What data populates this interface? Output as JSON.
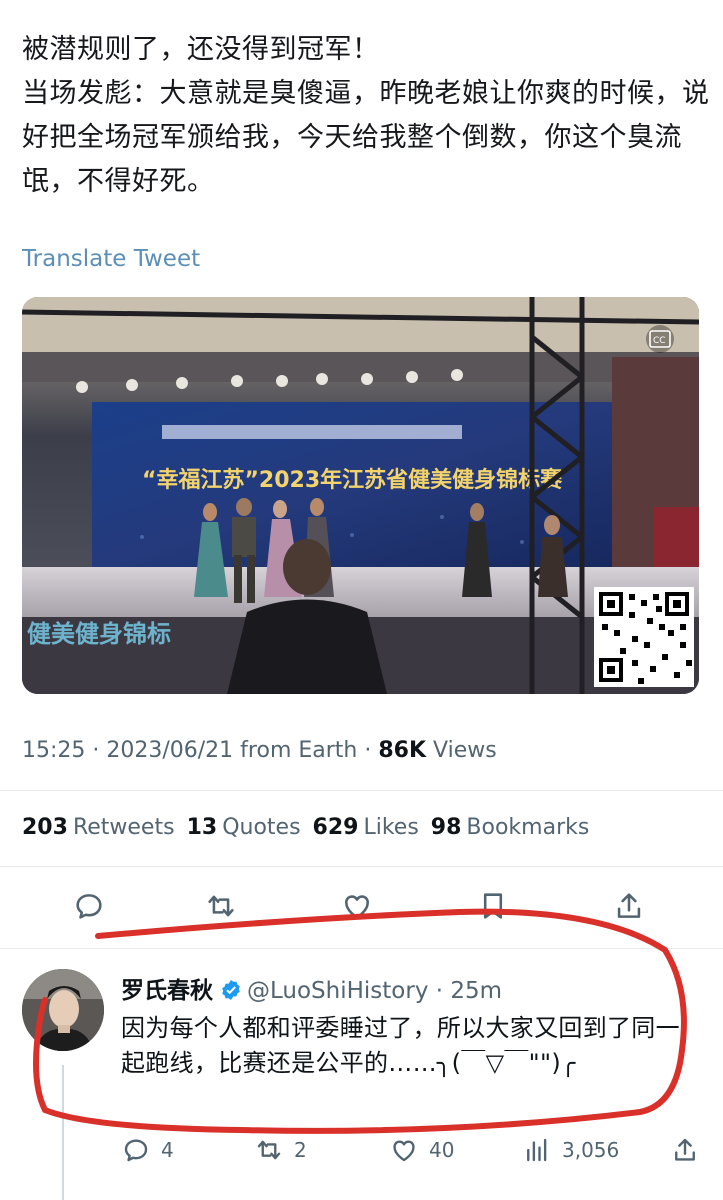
{
  "tweet": {
    "text": "被潜规则了，还没得到冠军！\n当场发彪：大意就是臭傻逼，昨晚老娘让你爽的时候，说好把全场冠军颁给我，今天给我整个倒数，你这个臭流氓，不得好死。",
    "translate_label": "Translate Tweet",
    "media": {
      "banner_text": "“幸福江苏”2023年江苏省健美健身锦标赛",
      "stage_text": "健美健身锦标",
      "cc_badge": "CC"
    },
    "time": "15:25 · 2023/06/21 from Earth · ",
    "views_count": "86K",
    "views_label": " Views",
    "stats": [
      {
        "count": "203",
        "label": "Retweets"
      },
      {
        "count": "13",
        "label": "Quotes"
      },
      {
        "count": "629",
        "label": "Likes"
      },
      {
        "count": "98",
        "label": "Bookmarks"
      }
    ],
    "actions": [
      "reply-icon",
      "retweet-icon",
      "like-icon",
      "bookmark-icon",
      "share-icon"
    ]
  },
  "reply": {
    "name": "罗氏春秋",
    "handle": "@LuoShiHistory · 25m",
    "text": "因为每个人都和评委睡过了，所以大家又回到了同一起跑线，比赛还是公平的……╮(￣▽￣\"\")╭",
    "counts": {
      "replies": "4",
      "retweets": "2",
      "likes": "40",
      "views": "3,056"
    }
  },
  "colors": {
    "link": "#5b8fb8",
    "secondary_text": "#536471",
    "verified": "#1d9bf0",
    "annotation": "#d9302a"
  }
}
